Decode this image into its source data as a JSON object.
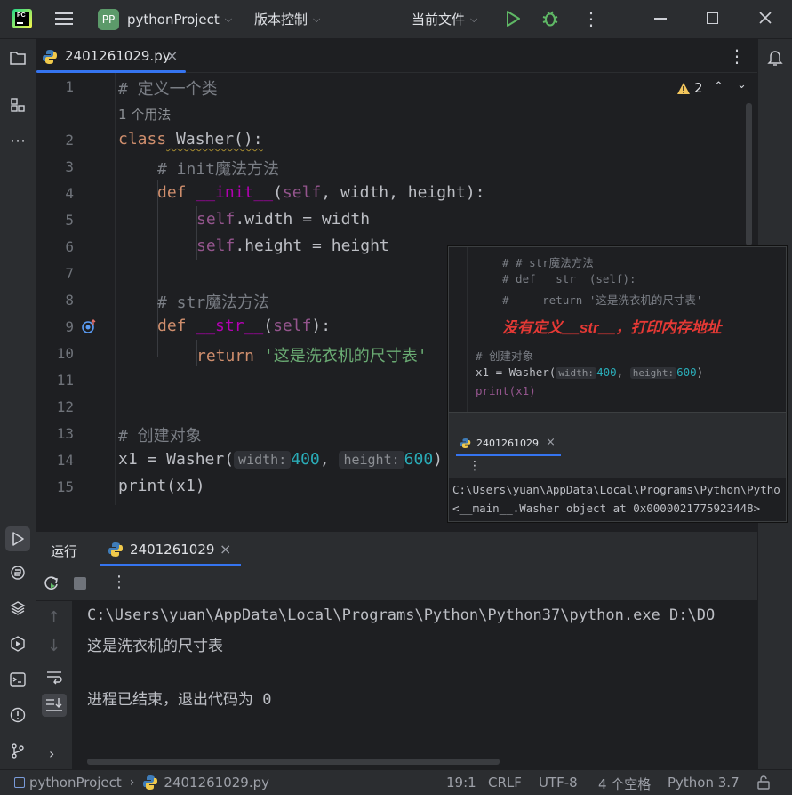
{
  "titlebar": {
    "project_badge": "PP",
    "project_name": "pythonProject",
    "vcs_label": "版本控制",
    "run_config": "当前文件"
  },
  "tabs": [
    {
      "label": "2401261029.py",
      "active": true
    }
  ],
  "editor": {
    "warnings_count": "2",
    "usages_hint": "1 个用法",
    "line_numbers": [
      "1",
      "2",
      "3",
      "4",
      "5",
      "6",
      "7",
      "8",
      "9",
      "10",
      "11",
      "12",
      "13",
      "14",
      "15"
    ],
    "code": {
      "l1": "# 定义一个类",
      "l2_kw": "class",
      "l2_name": " Washer():",
      "l3": "# init魔法方法",
      "l4_kw": "def",
      "l4_fn": "__init__",
      "l4_open": "(",
      "l4_self": "self",
      "l4_rest": ", width, height):",
      "l5_self": "self",
      "l5_rest": ".width = width",
      "l6_self": "self",
      "l6_rest": ".height = height",
      "l8": "# str魔法方法",
      "l9_kw": "def",
      "l9_fn": "__str__",
      "l9_open": "(",
      "l9_self": "self",
      "l9_rest": "):",
      "l10_kw": "return",
      "l10_str": "'这是洗衣机的尺寸表'",
      "l13": "# 创建对象",
      "l14_a": "x1 = Washer(",
      "l14_hint1": "width:",
      "l14_v1": "400",
      "l14_comma": ", ",
      "l14_hint2": "height:",
      "l14_v2": "600",
      "l14_close": ")",
      "l15": "print(x1)"
    }
  },
  "overlay": {
    "c1": "# # str魔法方法",
    "c2": "# def __str__(self):",
    "c3": "#     return '这是洗衣机的尺寸表'",
    "annotation": "没有定义__str__，打印内存地址",
    "c4": "# 创建对象",
    "c5_a": "x1 = Washer(",
    "c5_h1": "width:",
    "c5_v1": "400",
    "c5_h2": "height:",
    "c5_v2": "600",
    "c5_close": ")",
    "c6": "print(x1)",
    "tab_label": "2401261029",
    "out1": "C:\\Users\\yuan\\AppData\\Local\\Programs\\Python\\Pytho",
    "out2": "<__main__.Washer object at 0x0000021775923448>"
  },
  "run_panel": {
    "run_label": "运行",
    "tab_label": "2401261029",
    "output": [
      "C:\\Users\\yuan\\AppData\\Local\\Programs\\Python\\Python37\\python.exe D:\\DO",
      "这是洗衣机的尺寸表",
      "",
      "进程已结束，退出代码为 0"
    ]
  },
  "statusbar": {
    "project": "pythonProject",
    "file": "2401261029.py",
    "position": "19:1",
    "line_ending": "CRLF",
    "encoding": "UTF-8",
    "indent": "4 个空格",
    "interpreter": "Python 3.7"
  },
  "colors": {
    "accent": "#3574f0",
    "run_green": "#5fb865",
    "annotation_red": "#e53935"
  }
}
